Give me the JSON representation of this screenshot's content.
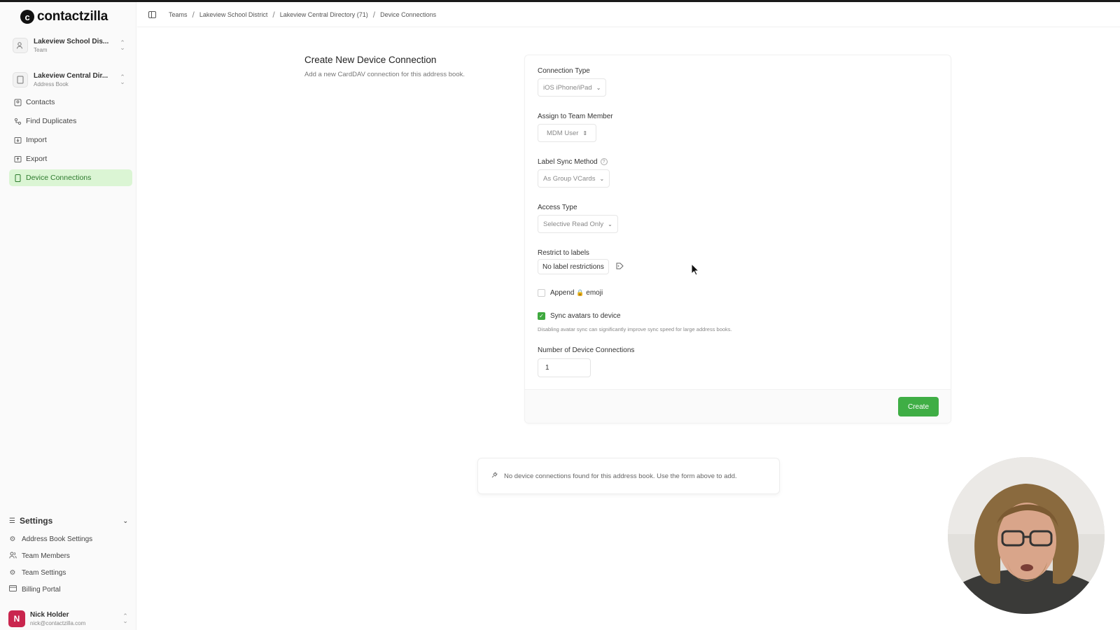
{
  "app": {
    "logo_text": "contactzilla"
  },
  "sidebar": {
    "team_switcher": {
      "name": "Lakeview School Dis...",
      "sub": "Team"
    },
    "book_switcher": {
      "name": "Lakeview Central Dir...",
      "sub": "Address Book"
    },
    "nav": [
      {
        "label": "Contacts",
        "icon": "contacts-icon"
      },
      {
        "label": "Find Duplicates",
        "icon": "duplicates-icon"
      },
      {
        "label": "Import",
        "icon": "import-icon"
      },
      {
        "label": "Export",
        "icon": "export-icon"
      },
      {
        "label": "Device Connections",
        "icon": "device-icon",
        "active": true
      }
    ],
    "settings": {
      "title": "Settings",
      "items": [
        {
          "label": "Address Book Settings",
          "icon": "gear-icon"
        },
        {
          "label": "Team Members",
          "icon": "users-icon"
        },
        {
          "label": "Team Settings",
          "icon": "gear-icon"
        },
        {
          "label": "Billing Portal",
          "icon": "card-icon"
        }
      ]
    },
    "user": {
      "initial": "N",
      "name": "Nick Holder",
      "email": "nick@contactzilla.com"
    }
  },
  "breadcrumb": [
    "Teams",
    "Lakeview School District",
    "Lakeview Central Directory (71)",
    "Device Connections"
  ],
  "form": {
    "title": "Create New Device Connection",
    "description": "Add a new CardDAV connection for this address book.",
    "connection_type": {
      "label": "Connection Type",
      "value": "iOS iPhone/iPad"
    },
    "assign_member": {
      "label": "Assign to Team Member",
      "value": "MDM User"
    },
    "label_sync": {
      "label": "Label Sync Method",
      "value": "As Group VCards"
    },
    "access_type": {
      "label": "Access Type",
      "value": "Selective Read Only"
    },
    "restrict": {
      "label": "Restrict to labels",
      "value": "No label restrictions"
    },
    "append_emoji": {
      "label_prefix": "Append",
      "emoji": "🔒",
      "label_suffix": "emoji",
      "checked": false
    },
    "sync_avatars": {
      "label": "Sync avatars to device",
      "checked": true,
      "hint": "Disabling avatar sync can significantly improve sync speed for large address books."
    },
    "num_connections": {
      "label": "Number of Device Connections",
      "value": "1"
    },
    "create_label": "Create"
  },
  "empty_state": "No device connections found for this address book. Use the form above to add.",
  "colors": {
    "accent": "#3fae45",
    "active_bg": "#dbf5d4",
    "avatar": "#c9264e"
  }
}
